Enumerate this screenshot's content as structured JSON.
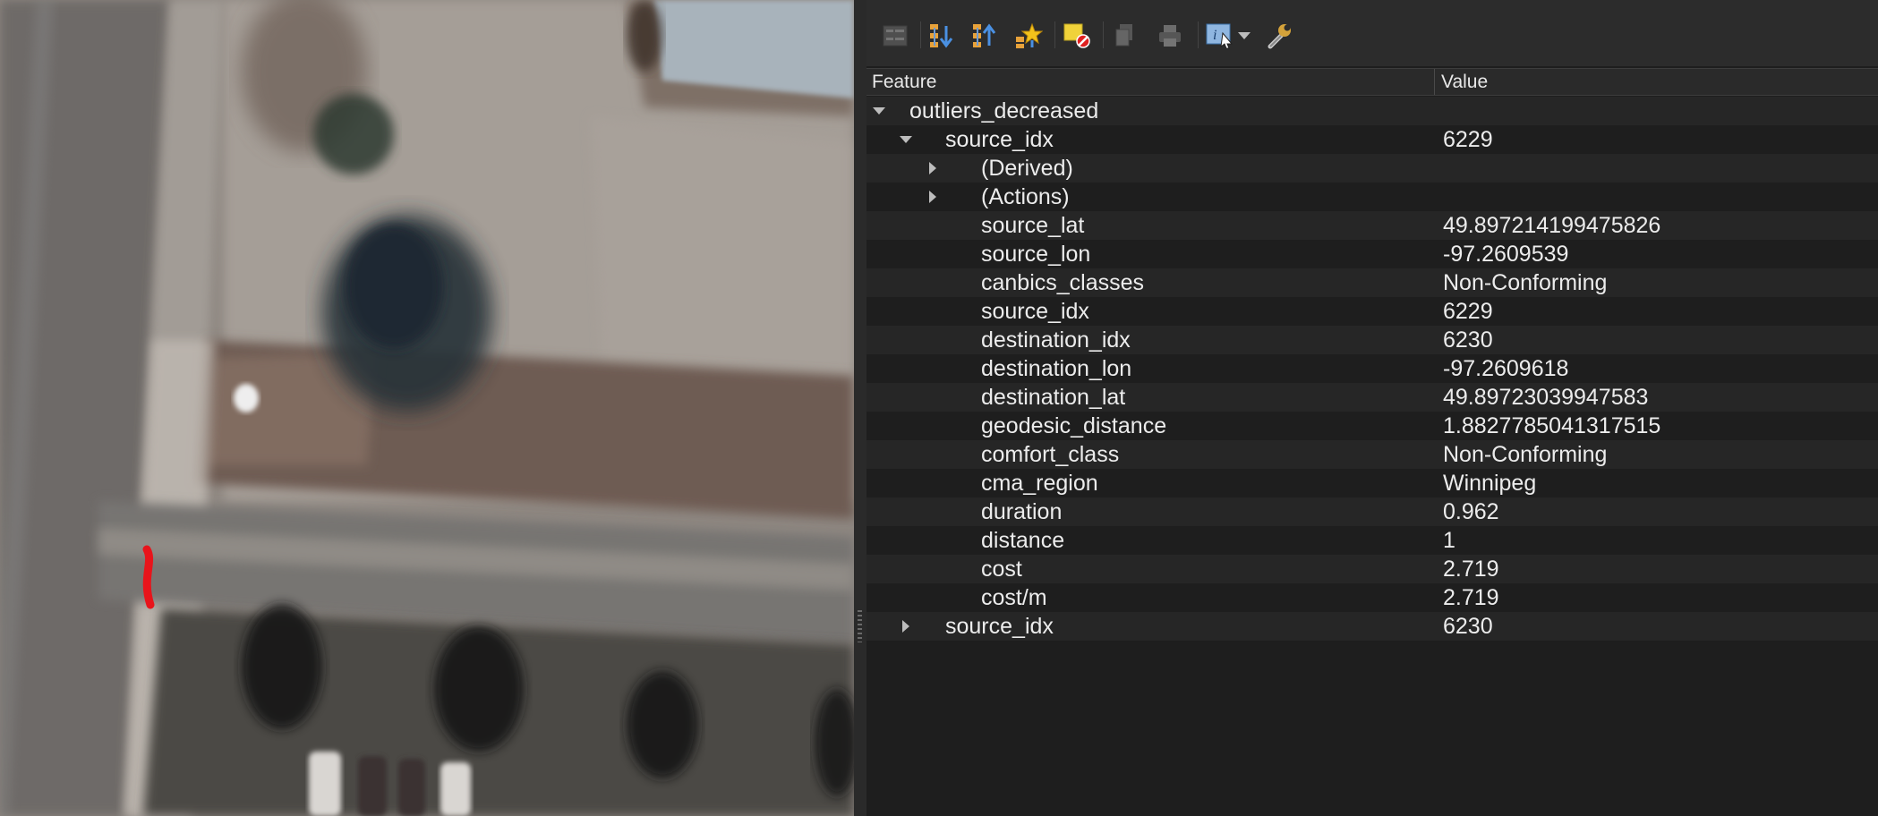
{
  "map": {
    "description_icon": "aerial-imagery",
    "selection_color": "#e8141b"
  },
  "toolbar": {
    "buttons": [
      {
        "name": "expand-new-results-icon",
        "enabled": false
      },
      {
        "name": "expand-tree-icon",
        "enabled": true
      },
      {
        "name": "collapse-tree-icon",
        "enabled": true
      },
      {
        "name": "highlight-features-icon",
        "enabled": true
      },
      {
        "name": "clear-results-icon",
        "enabled": true
      },
      {
        "name": "copy-feature-icon",
        "enabled": false
      },
      {
        "name": "print-icon",
        "enabled": false
      },
      {
        "name": "identify-mode-icon",
        "enabled": true
      },
      {
        "name": "dropdown-arrow-icon",
        "enabled": true
      },
      {
        "name": "settings-wrench-icon",
        "enabled": true
      }
    ]
  },
  "headers": {
    "feature": "Feature",
    "value": "Value"
  },
  "tree": {
    "layer": "outliers_decreased",
    "feature1": {
      "label": "source_idx",
      "value": "6229"
    },
    "derived": "(Derived)",
    "actions": "(Actions)",
    "attributes": [
      {
        "name": "source_lat",
        "value": "49.897214199475826"
      },
      {
        "name": "source_lon",
        "value": "-97.2609539"
      },
      {
        "name": "canbics_classes",
        "value": "Non-Conforming"
      },
      {
        "name": "source_idx",
        "value": "6229"
      },
      {
        "name": "destination_idx",
        "value": "6230"
      },
      {
        "name": "destination_lon",
        "value": "-97.2609618"
      },
      {
        "name": "destination_lat",
        "value": "49.89723039947583"
      },
      {
        "name": "geodesic_distance",
        "value": "1.8827785041317515"
      },
      {
        "name": "comfort_class",
        "value": "Non-Conforming"
      },
      {
        "name": "cma_region",
        "value": "Winnipeg"
      },
      {
        "name": "duration",
        "value": "0.962"
      },
      {
        "name": "distance",
        "value": "1"
      },
      {
        "name": "cost",
        "value": "2.719"
      },
      {
        "name": "cost/m",
        "value": "2.719"
      }
    ],
    "feature2": {
      "label": "source_idx",
      "value": "6230"
    }
  }
}
